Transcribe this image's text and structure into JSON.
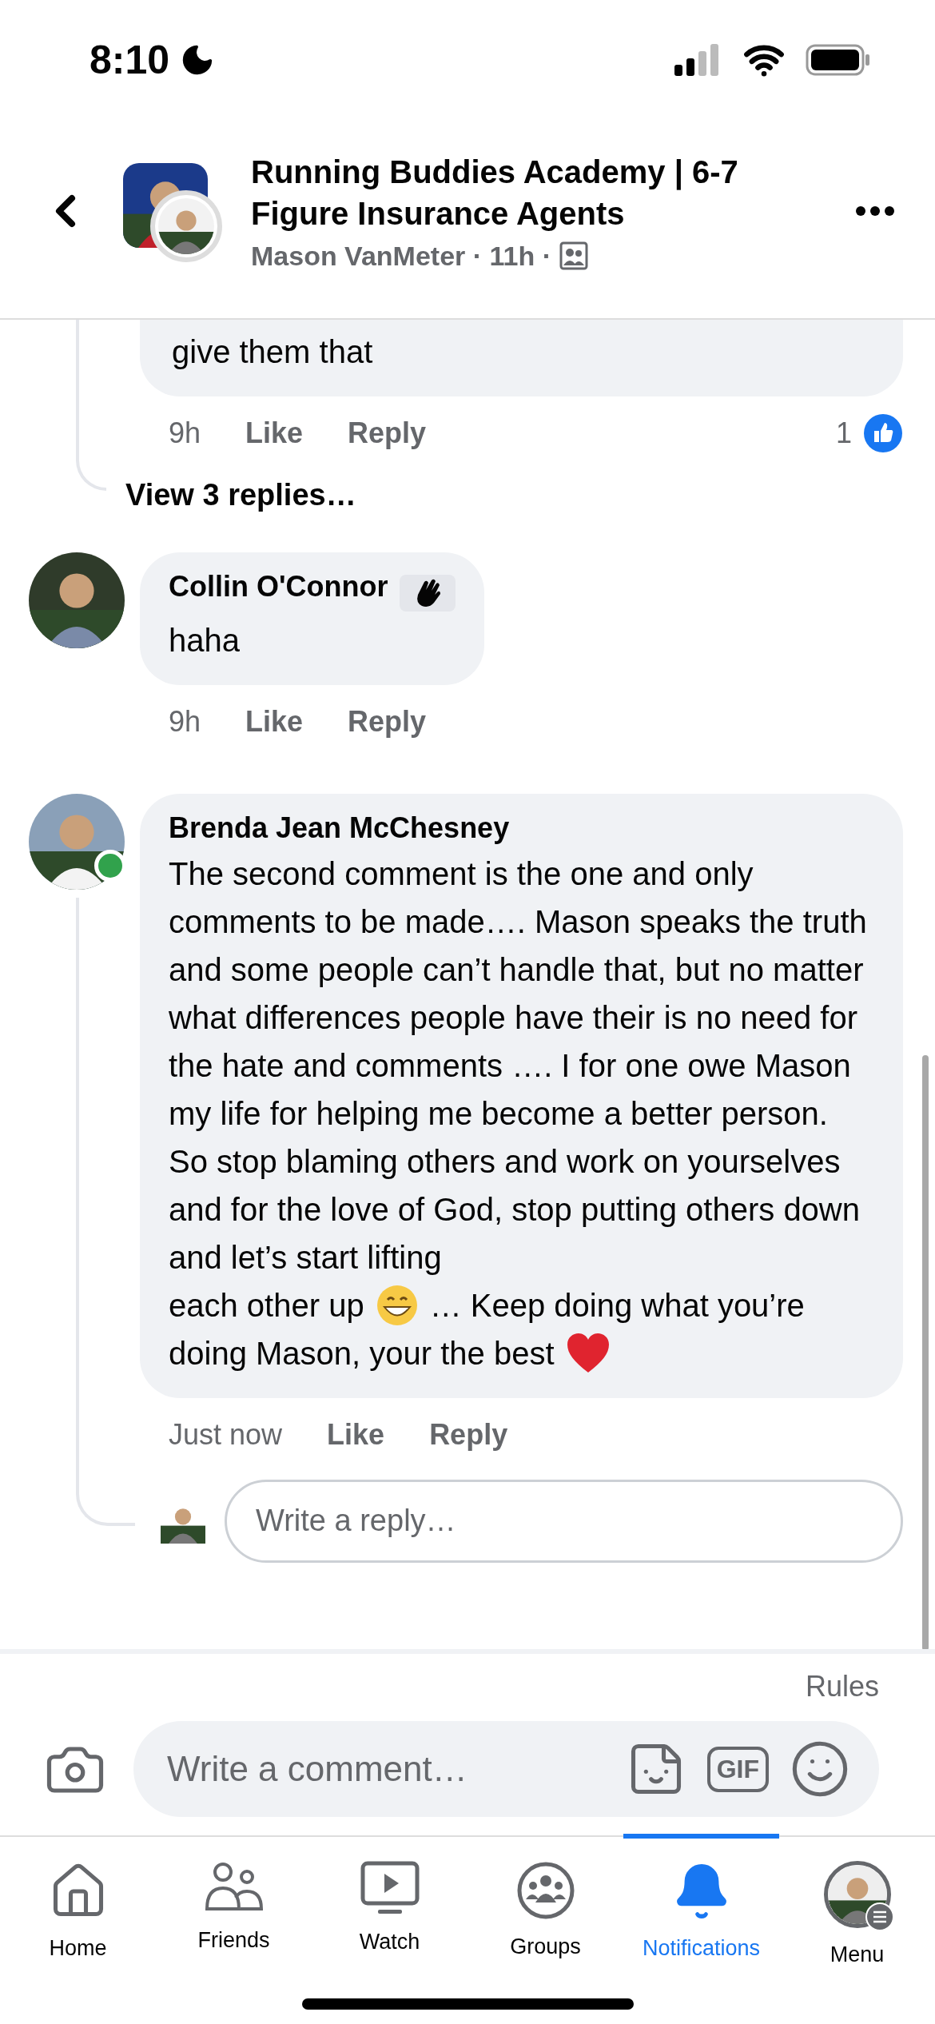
{
  "status_bar": {
    "time": "8:10"
  },
  "header": {
    "title": "Running Buddies Academy | 6-7 Figure Insurance Agents",
    "meta": "Mason VanMeter · 11h ·"
  },
  "earlier_reply": {
    "text": "give them that",
    "time": "9h",
    "like": "Like",
    "reply": "Reply",
    "reaction_count": "1",
    "replies_link": "View 3 replies…"
  },
  "comments": [
    {
      "author": "Collin O'Connor",
      "online": false,
      "wave_badge": true,
      "body": [
        {
          "kind": "text",
          "text": "haha"
        }
      ],
      "time": "9h",
      "like": "Like",
      "reply": "Reply",
      "has_reply_box": false
    },
    {
      "author": "Brenda Jean McChesney",
      "online": true,
      "wave_badge": false,
      "body": [
        {
          "kind": "text",
          "text": "The second comment is the one and only comments to be made…. Mason speaks the truth and some people can’t handle that, but no matter what differences people have their is no need for the hate and comments …. I for one owe Mason my life for helping me become a better person. So stop blaming others and work on yourselves and for the love of God, stop putting others down and let’s start lifting"
        },
        {
          "kind": "line",
          "parts": [
            {
              "kind": "text",
              "text": "each other up"
            },
            {
              "kind": "grin"
            },
            {
              "kind": "text",
              "text": "… Keep doing what you’re"
            }
          ]
        },
        {
          "kind": "line",
          "parts": [
            {
              "kind": "text",
              "text": "doing Mason, your the best"
            },
            {
              "kind": "heart"
            }
          ]
        }
      ],
      "time": "Just now",
      "like": "Like",
      "reply": "Reply",
      "has_reply_box": true
    }
  ],
  "reply_box": {
    "placeholder": "Write a reply…"
  },
  "composer": {
    "rules": "Rules",
    "placeholder": "Write a comment…",
    "gif": "GIF"
  },
  "tabs": [
    {
      "kind": "home",
      "label": "Home",
      "selected": false
    },
    {
      "kind": "friends",
      "label": "Friends",
      "selected": false
    },
    {
      "kind": "watch",
      "label": "Watch",
      "selected": false
    },
    {
      "kind": "groups",
      "label": "Groups",
      "selected": false
    },
    {
      "kind": "notifications",
      "label": "Notifications",
      "selected": true
    },
    {
      "kind": "menu",
      "label": "Menu",
      "selected": false
    }
  ]
}
